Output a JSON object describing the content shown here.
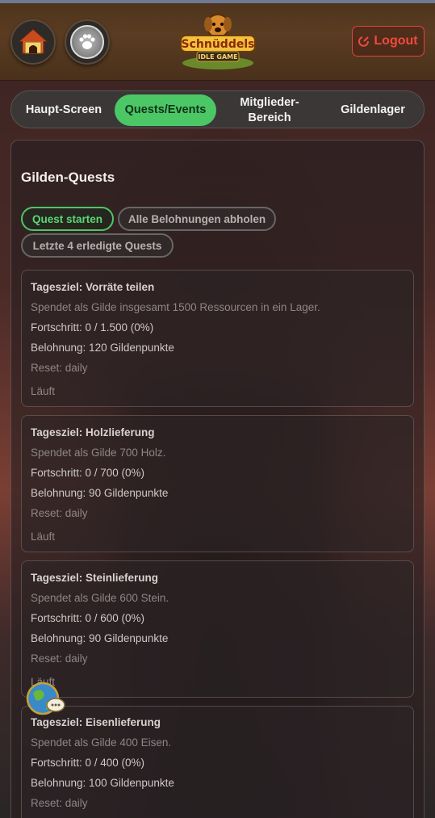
{
  "header": {
    "home_icon": "doghouse-icon",
    "paw_icon": "paw-icon",
    "logo_title": "Schnüddels",
    "logo_subtitle": "IDLE GAME",
    "logout_label": "Logout",
    "logout_color": "#f04a3e"
  },
  "tabs": [
    {
      "label": "Haupt-Screen",
      "active": false
    },
    {
      "label": "Quests/Events",
      "active": true
    },
    {
      "label": "Mitglieder-Bereich",
      "active": false
    },
    {
      "label": "Gildenlager",
      "active": false
    }
  ],
  "accent_color": "#4cc765",
  "panel": {
    "title": "Gilden-Quests",
    "buttons": {
      "start": "Quest starten",
      "claim_all": "Alle Belohnungen abholen",
      "last_four": "Letzte 4 erledigte Quests"
    },
    "quests": [
      {
        "title": "Tagesziel: Vorräte teilen",
        "description": "Spendet als Gilde insgesamt 1500 Ressourcen in ein Lager.",
        "progress": "Fortschritt: 0 / 1.500 (0%)",
        "reward": "Belohnung: 120 Gildenpunkte",
        "reset": "Reset: daily",
        "status": "Läuft"
      },
      {
        "title": "Tagesziel: Holzlieferung",
        "description": "Spendet als Gilde 700 Holz.",
        "progress": "Fortschritt: 0 / 700 (0%)",
        "reward": "Belohnung: 90 Gildenpunkte",
        "reset": "Reset: daily",
        "status": "Läuft"
      },
      {
        "title": "Tagesziel: Steinlieferung",
        "description": "Spendet als Gilde 600 Stein.",
        "progress": "Fortschritt: 0 / 600 (0%)",
        "reward": "Belohnung: 90 Gildenpunkte",
        "reset": "Reset: daily",
        "status": "Läuft"
      },
      {
        "title": "Tagesziel: Eisenlieferung",
        "description": "Spendet als Gilde 400 Eisen.",
        "progress": "Fortschritt: 0 / 400 (0%)",
        "reward": "Belohnung: 100 Gildenpunkte",
        "reset": "Reset: daily",
        "status": ""
      }
    ]
  },
  "floating": {
    "chat_icon": "globe-chat-icon"
  }
}
